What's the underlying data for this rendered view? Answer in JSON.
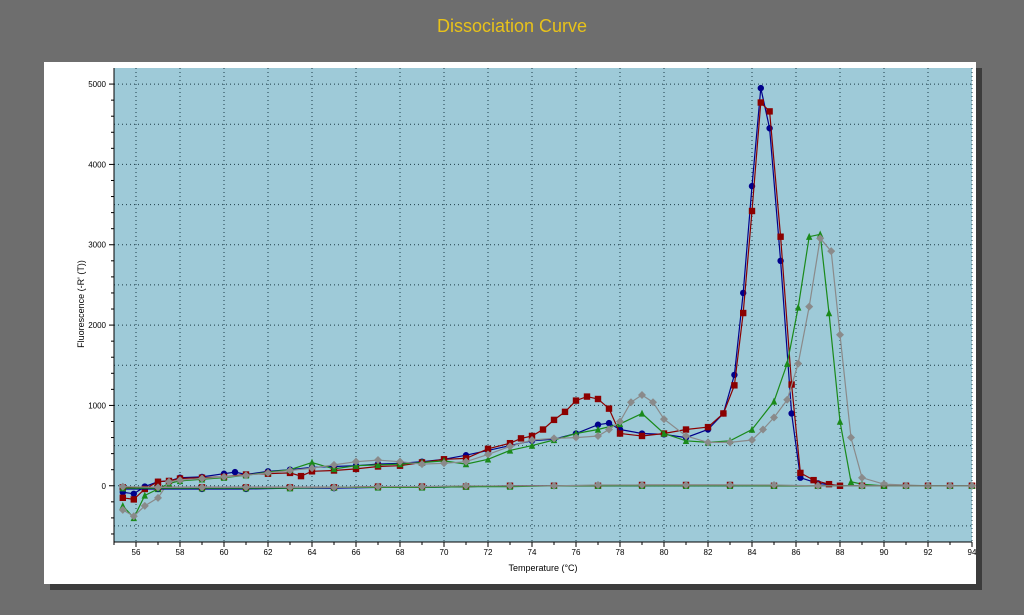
{
  "chart_data": {
    "type": "line",
    "title": "Dissociation Curve",
    "xlabel": "Temperature (°C)",
    "ylabel": "Fluorescence (-R' (T))",
    "xlim": [
      55,
      94
    ],
    "ylim": [
      -700,
      5200
    ],
    "x_ticks": [
      "56",
      "58",
      "60",
      "62",
      "64",
      "66",
      "68",
      "70",
      "72",
      "74",
      "76",
      "78",
      "80",
      "82",
      "84",
      "86",
      "88",
      "90",
      "92",
      "94"
    ],
    "y_ticks": [
      "0",
      "1000",
      "2000",
      "3000",
      "4000",
      "5000"
    ],
    "grid": true,
    "legend": "none",
    "plot_background": "#9ecad8",
    "series": [
      {
        "color": "#00008b",
        "marker": "circle",
        "x": [
          55.4,
          55.9,
          56.4,
          57,
          57.5,
          58,
          59,
          60,
          60.5,
          61,
          62,
          63,
          64,
          65,
          66,
          67,
          68,
          69,
          70,
          71,
          72,
          73,
          74,
          75,
          76,
          77,
          77.5,
          78,
          79,
          80,
          81,
          82,
          82.7,
          83.2,
          83.6,
          84,
          84.4,
          84.8,
          85.3,
          85.8,
          86.2,
          87,
          88,
          90,
          92,
          94
        ],
        "y": [
          -80,
          -100,
          -10,
          50,
          60,
          100,
          110,
          150,
          170,
          140,
          180,
          200,
          230,
          240,
          250,
          270,
          280,
          300,
          330,
          380,
          440,
          500,
          560,
          580,
          650,
          760,
          780,
          700,
          650,
          640,
          600,
          700,
          900,
          1380,
          2400,
          3730,
          4950,
          4450,
          2800,
          900,
          100,
          30,
          0,
          0,
          0,
          0
        ]
      },
      {
        "color": "#8b0000",
        "marker": "square",
        "x": [
          55.4,
          55.9,
          56.4,
          57,
          57.5,
          58,
          59,
          60,
          61,
          62,
          63,
          63.5,
          64,
          65,
          66,
          67,
          68,
          69,
          70,
          71,
          72,
          73,
          73.5,
          74,
          74.5,
          75,
          75.5,
          76,
          76.5,
          77,
          77.5,
          78,
          79,
          80,
          81,
          82,
          82.7,
          83.2,
          83.6,
          84,
          84.4,
          84.8,
          85.3,
          85.8,
          86.2,
          86.8,
          87.5,
          88,
          90,
          92,
          94
        ],
        "y": [
          -150,
          -170,
          -40,
          50,
          60,
          90,
          100,
          110,
          140,
          150,
          160,
          120,
          180,
          190,
          210,
          240,
          250,
          290,
          330,
          340,
          460,
          530,
          590,
          620,
          700,
          820,
          920,
          1060,
          1110,
          1080,
          960,
          650,
          620,
          650,
          700,
          730,
          900,
          1250,
          2150,
          3420,
          4770,
          4660,
          3100,
          1260,
          160,
          70,
          20,
          0,
          0,
          0,
          0
        ]
      },
      {
        "color": "#1a8a1a",
        "marker": "triangle",
        "x": [
          55.4,
          55.9,
          56.4,
          57,
          57.5,
          58,
          59,
          60,
          61,
          62,
          63,
          64,
          65,
          66,
          67,
          68,
          69,
          70,
          71,
          72,
          73,
          74,
          75,
          76,
          77,
          78,
          79,
          80,
          81,
          82,
          83,
          84,
          85,
          85.6,
          86.1,
          86.6,
          87.1,
          87.5,
          88,
          88.5,
          89,
          90,
          92,
          94
        ],
        "y": [
          -250,
          -400,
          -120,
          -40,
          30,
          60,
          80,
          100,
          130,
          170,
          200,
          290,
          210,
          250,
          260,
          270,
          290,
          310,
          270,
          330,
          440,
          500,
          570,
          650,
          700,
          770,
          900,
          650,
          560,
          540,
          560,
          700,
          1050,
          1520,
          2220,
          3100,
          3130,
          2150,
          800,
          50,
          20,
          0,
          0,
          0
        ]
      },
      {
        "color": "#8a8a8a",
        "marker": "diamond",
        "x": [
          55.4,
          55.9,
          56.4,
          57,
          57.5,
          58,
          59,
          60,
          61,
          62,
          63,
          64,
          65,
          66,
          67,
          68,
          69,
          70,
          71,
          72,
          73,
          74,
          75,
          76,
          77,
          77.5,
          78,
          78.5,
          79,
          79.5,
          80,
          81,
          82,
          83,
          84,
          84.5,
          85,
          85.6,
          86.1,
          86.6,
          87.1,
          87.6,
          88,
          88.5,
          89,
          90,
          92,
          94
        ],
        "y": [
          -300,
          -380,
          -250,
          -150,
          50,
          70,
          90,
          110,
          130,
          160,
          190,
          220,
          260,
          300,
          320,
          300,
          270,
          280,
          300,
          390,
          490,
          570,
          590,
          600,
          620,
          700,
          800,
          1040,
          1130,
          1040,
          830,
          620,
          540,
          540,
          570,
          700,
          850,
          1070,
          1520,
          2230,
          3080,
          2920,
          1880,
          600,
          100,
          20,
          0,
          0
        ]
      },
      {
        "color": "#00008b",
        "marker": "circle",
        "x": [
          55.4,
          57,
          59,
          61,
          63,
          65,
          67,
          69,
          71,
          73,
          75,
          77,
          79,
          81,
          83,
          85,
          87,
          89,
          91,
          93,
          94
        ],
        "y": [
          -40,
          -40,
          -40,
          -40,
          -30,
          -30,
          -20,
          -20,
          -10,
          0,
          0,
          0,
          0,
          0,
          0,
          0,
          0,
          0,
          0,
          0,
          0
        ]
      },
      {
        "color": "#8b0000",
        "marker": "square",
        "x": [
          55.4,
          57,
          59,
          61,
          63,
          65,
          67,
          69,
          71,
          73,
          75,
          77,
          79,
          81,
          83,
          85,
          87,
          89,
          91,
          93,
          94
        ],
        "y": [
          -20,
          -20,
          -20,
          -20,
          -20,
          -20,
          -10,
          -10,
          -10,
          0,
          0,
          0,
          10,
          10,
          10,
          0,
          0,
          0,
          0,
          0,
          0
        ]
      },
      {
        "color": "#1a8a1a",
        "marker": "triangle",
        "x": [
          55.4,
          57,
          59,
          61,
          63,
          65,
          67,
          69,
          71,
          73,
          75,
          77,
          79,
          81,
          83,
          85,
          87,
          89,
          91,
          93,
          94
        ],
        "y": [
          -30,
          -30,
          -30,
          -30,
          -30,
          -20,
          -20,
          -20,
          -10,
          -10,
          0,
          0,
          0,
          0,
          0,
          0,
          0,
          0,
          0,
          0,
          0
        ]
      },
      {
        "color": "#8a8a8a",
        "marker": "diamond",
        "x": [
          55.4,
          57,
          59,
          61,
          63,
          65,
          67,
          69,
          71,
          73,
          75,
          77,
          79,
          81,
          83,
          85,
          87,
          89,
          91,
          93,
          94
        ],
        "y": [
          -10,
          -20,
          -20,
          -20,
          -20,
          -20,
          -10,
          -10,
          0,
          0,
          0,
          10,
          10,
          10,
          10,
          10,
          0,
          0,
          0,
          0,
          0
        ]
      }
    ]
  }
}
